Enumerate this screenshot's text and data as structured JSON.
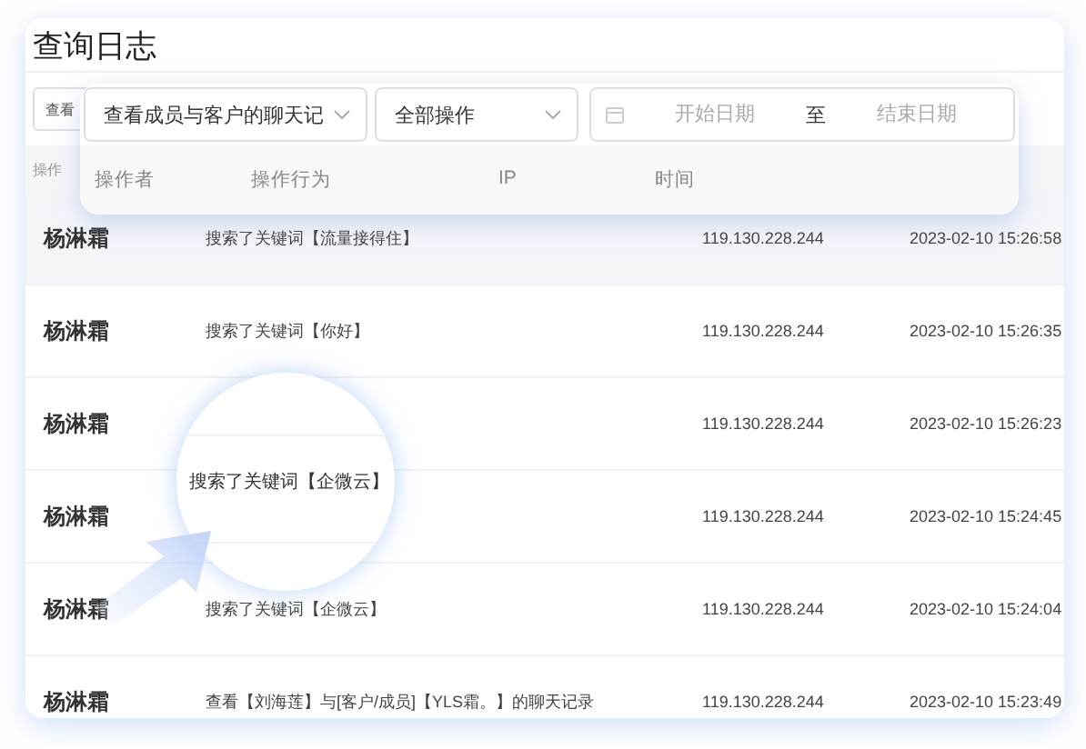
{
  "title": "查询日志",
  "toolbar_behind": {
    "select_text": "查看"
  },
  "header_behind": {
    "label": "操作"
  },
  "filter_card": {
    "selects": [
      {
        "value": "查看成员与客户的聊天记"
      },
      {
        "value": "全部操作"
      }
    ],
    "date_range": {
      "start_placeholder": "开始日期",
      "separator": "至",
      "end_placeholder": "结束日期"
    },
    "columns": [
      "操作者",
      "操作行为",
      "IP",
      "时间"
    ]
  },
  "rows": [
    {
      "operator": "杨淋霜",
      "action": "搜索了关键词【流量接得住】",
      "ip": "119.130.228.244",
      "time": "2023-02-10 15:26:58",
      "selected": true
    },
    {
      "operator": "杨淋霜",
      "action": "搜索了关键词【你好】",
      "ip": "119.130.228.244",
      "time": "2023-02-10 15:26:35",
      "selected": false
    },
    {
      "operator": "杨淋霜",
      "ip": "119.130.228.244",
      "time": "2023-02-10 15:26:23",
      "selected": false
    },
    {
      "operator": "杨淋霜",
      "ip": "119.130.228.244",
      "time": "2023-02-10 15:24:45",
      "selected": false
    },
    {
      "operator": "杨淋霜",
      "action": "搜索了关键词【企微云】",
      "ip": "119.130.228.244",
      "time": "2023-02-10 15:24:04",
      "selected": false
    },
    {
      "operator": "杨淋霜",
      "action": "查看【刘海莲】与[客户/成员]【YLS霜。】的聊天记录",
      "ip": "119.130.228.244",
      "time": "2023-02-10 15:23:49",
      "selected": false
    }
  ],
  "magnifier": {
    "text": "搜索了关键词【企微云】"
  }
}
